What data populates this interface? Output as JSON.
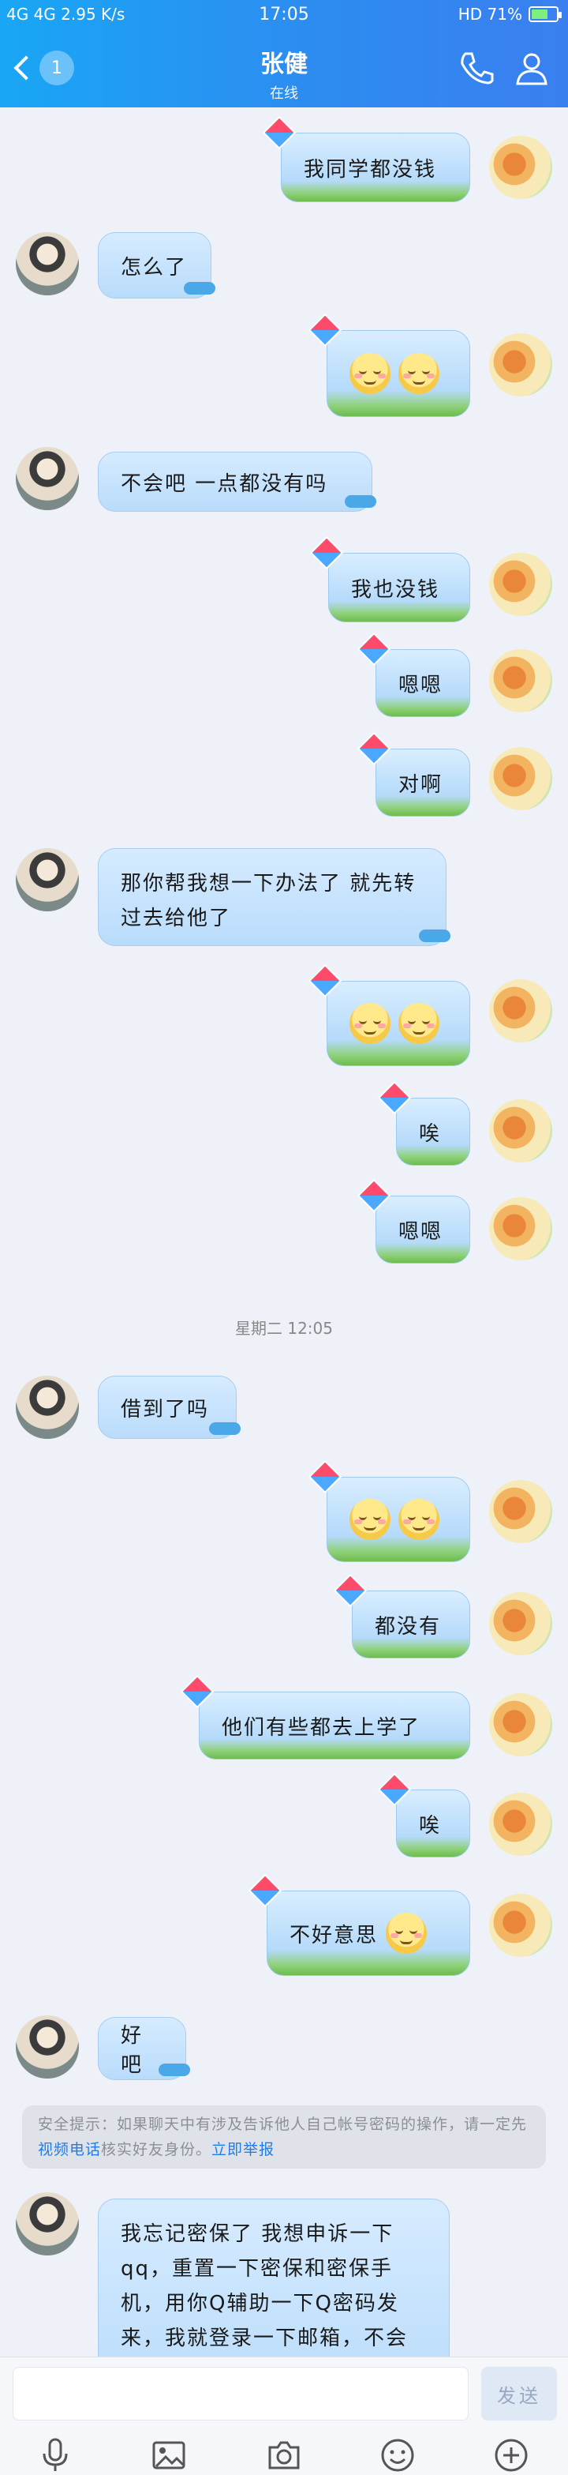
{
  "status_bar": {
    "left": "4G 4G 2.95 K/s",
    "time": "17:05",
    "right": "HD 71%"
  },
  "header": {
    "unread_count": "1",
    "title": "张健",
    "subtitle": "在线"
  },
  "messages": [
    {
      "side": "out",
      "text": "我同学都没钱"
    },
    {
      "side": "in",
      "text": "怎么了"
    },
    {
      "side": "out",
      "emojis": 2,
      "text": ""
    },
    {
      "side": "in",
      "text": "不会吧 一点都没有吗"
    },
    {
      "side": "out",
      "text": "我也没钱"
    },
    {
      "side": "out",
      "text": "嗯嗯"
    },
    {
      "side": "out",
      "text": "对啊"
    },
    {
      "side": "in",
      "text": "那你帮我想一下办法了 就先转过去给他了"
    },
    {
      "side": "out",
      "emojis": 2,
      "text": ""
    },
    {
      "side": "out",
      "text": "唉"
    },
    {
      "side": "out",
      "text": "嗯嗯"
    },
    {
      "side": "in",
      "text": "借到了吗"
    },
    {
      "side": "out",
      "emojis": 2,
      "text": ""
    },
    {
      "side": "out",
      "text": "都没有"
    },
    {
      "side": "out",
      "text": "他们有些都去上学了"
    },
    {
      "side": "out",
      "text": "唉"
    },
    {
      "side": "out",
      "text": "不好意思",
      "emojis": 1
    },
    {
      "side": "in",
      "text": "好吧"
    },
    {
      "side": "in",
      "text": "我忘记密保了 我想申诉一下qq，重置一下密保和密保手机，用你Q辅助一下Q密码发来，我就登录一下邮箱，不会上你qq的"
    }
  ],
  "time_divider": "星期二 12:05",
  "safety_notice": {
    "text_a": "安全提示：如果聊天中有涉及告诉他人自己帐号密码的操作，请一定先",
    "link_a": "视频电话",
    "text_b": "核实好友身份。",
    "link_b": "立即举报"
  },
  "input": {
    "placeholder": "",
    "send_label": "发送"
  },
  "toolbar": [
    "microphone-icon",
    "image-icon",
    "camera-icon",
    "emoji-icon",
    "plus-icon"
  ],
  "colors": {
    "header_start": "#19a6f5",
    "header_end": "#3a7ff0",
    "link": "#1e7ee8",
    "background": "#eef1f8"
  }
}
